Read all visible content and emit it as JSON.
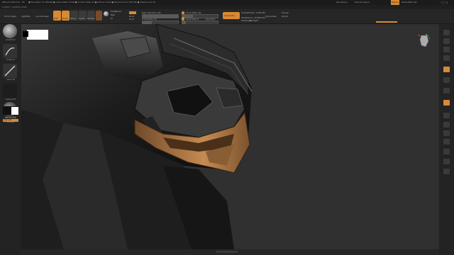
{
  "title": {
    "app": "ZBrush 2021.6.6",
    "doc": "P4",
    "info": "● Free Mem 47.483GB ● Active Mem 9799 ● Scratch Disk 47 ● ZTime 0.321 ● PolyCount 27.740 MP ● MeshCount 16",
    "quicksave": "QuickSave",
    "see_through": "See-through 0",
    "menus_btn": "Menus",
    "script": "DefaultZScript"
  },
  "menu": [
    "Alpha",
    "Brush",
    "Color",
    "Document",
    "Draw",
    "Dynamics",
    "Edit",
    "File",
    "Layer",
    "Light",
    "Macro",
    "Marker",
    "Material",
    "Movie",
    "Picker",
    "Preferences",
    "Render",
    "Stencil",
    "Stroke",
    "Texture",
    "Tool",
    "Transform",
    "Zplugin",
    "Zscript",
    "Help"
  ],
  "status_left": "X 2051 Y 1028 Z 0.000",
  "shelf": {
    "home_page": "Home Page",
    "lightbox": "LightBox",
    "live_boolean": "Live Boolean",
    "edit": "Edit",
    "draw": "Draw",
    "move": "Move",
    "scale": "Scale",
    "rotate": "Rotate",
    "mrgb": "Mrgb",
    "rgb": "Rgb",
    "m": "M",
    "zadd": "Zadd",
    "zsub": "Zsub",
    "zcut": "Zcut",
    "rgb_intensity": "Rgb Intensity 100",
    "z_intensity": "Z Intensity 25",
    "focal_shift": "Focal Shift -40",
    "draw_size": "Draw Size 6",
    "dynamic": "Dynamic",
    "active_points": "ActivePoints: 3.458 Mil",
    "total_points": "TotalPoints: 29.883 Mil",
    "symmetry": "Symmetry",
    "polyframe": "Polyframe",
    "dynamesh": "Dynamesh",
    "spotlight": "Spotlight",
    "solo": "Solo",
    "transp": "Transp",
    "ghost": "Ghost"
  },
  "left_tray": {
    "brush_label": "SnakeHook",
    "stroke_label": "FreeHand",
    "alpha_label": "Alpha Off",
    "texture_label": "Texture Off",
    "material_label": "MatCap Gray",
    "color_label": "Gradient",
    "switch_label": "SwitchColor",
    "alternate_label": "Alternate"
  },
  "colors": {
    "accent": "#d88a33",
    "panel": "#232323",
    "canvas": "#303030"
  }
}
